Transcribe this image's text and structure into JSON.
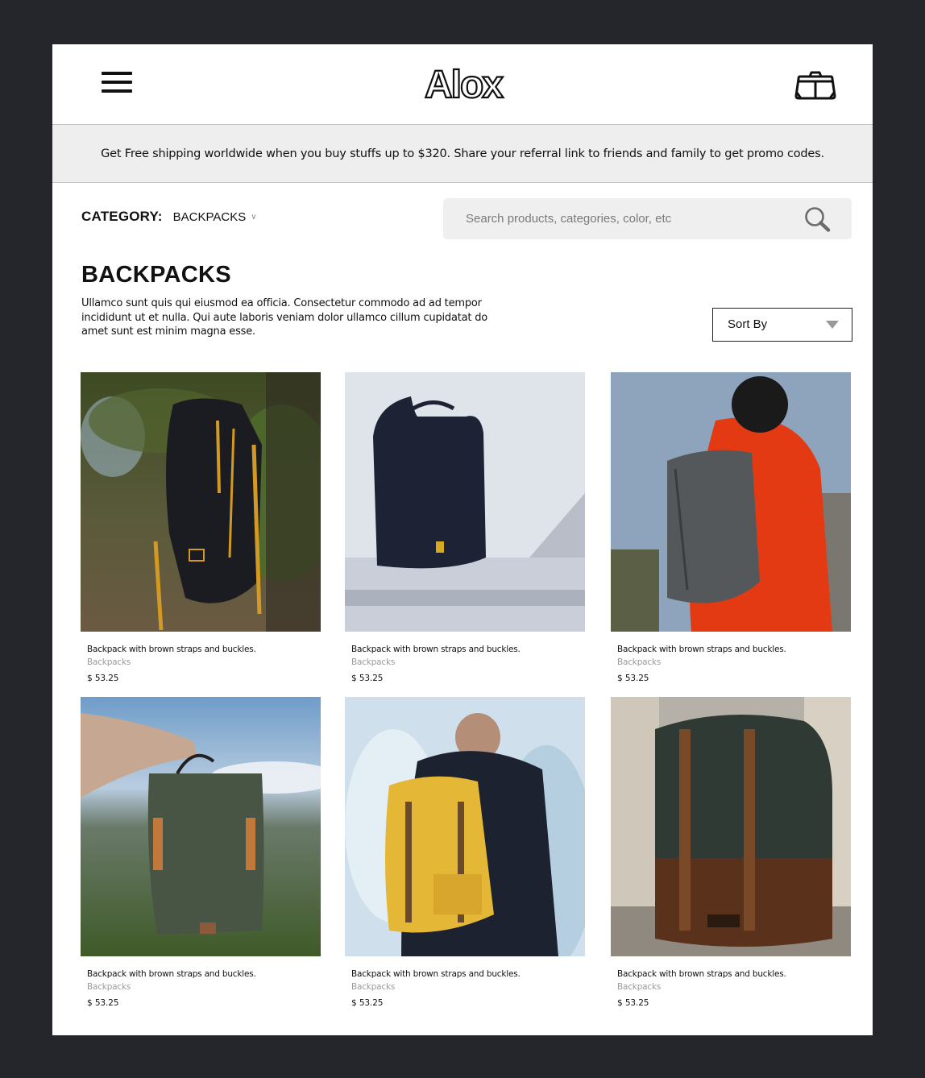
{
  "header": {
    "logo_text": "Alox",
    "menu_icon": "hamburger-menu-icon",
    "cart_icon": "shopping-bag-icon"
  },
  "promo": {
    "text": "Get Free shipping worldwide when you buy stuffs up to $320. Share your referral link to friends and family to get promo codes."
  },
  "filters": {
    "category_label": "CATEGORY:",
    "category_value": "BACKPACKS",
    "category_chevron": "chevron-down-icon"
  },
  "search": {
    "placeholder": "Search products, categories, color, etc",
    "value": "",
    "icon": "search-icon"
  },
  "section": {
    "title": "BACKPACKS",
    "description": "Ullamco sunt quis qui eiusmod ea officia. Consectetur commodo ad ad tempor incididunt ut et nulla. Qui aute laboris veniam dolor ullamco cillum cupidatat do amet sunt est minim magna esse."
  },
  "sort": {
    "label": "Sort By"
  },
  "products": [
    {
      "name": "Backpack with brown straps and buckles.",
      "category": "Backpacks",
      "price": "$ 53.25",
      "image": "black backpack with orange straps hanging on tree"
    },
    {
      "name": "Backpack with brown straps and buckles.",
      "category": "Backpacks",
      "price": "$ 53.25",
      "image": "navy backpack on white floor"
    },
    {
      "name": "Backpack with brown straps and buckles.",
      "category": "Backpacks",
      "price": "$ 53.25",
      "image": "man in red hoodie wearing grey backpack"
    },
    {
      "name": "Backpack with brown straps and buckles.",
      "category": "Backpacks",
      "price": "$ 53.25",
      "image": "hand holding green backpack over mountains"
    },
    {
      "name": "Backpack with brown straps and buckles.",
      "category": "Backpacks",
      "price": "$ 53.25",
      "image": "man wearing yellow backpack in snow"
    },
    {
      "name": "Backpack with brown straps and buckles.",
      "category": "Backpacks",
      "price": "$ 53.25",
      "image": "green canvas backpack with leather straps"
    }
  ]
}
